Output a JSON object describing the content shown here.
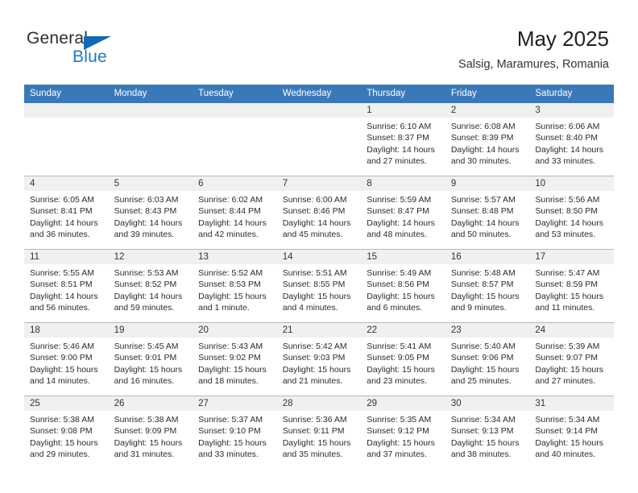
{
  "brand": {
    "word_one": "General",
    "word_two": "Blue",
    "flag_icon": "triangle-flag-icon",
    "accent_color": "#1268b3"
  },
  "header": {
    "title": "May 2025",
    "subtitle": "Salsig, Maramures, Romania"
  },
  "theme": {
    "header_bg": "#3a79b8",
    "header_text": "#ffffff",
    "daynum_bg": "#f0f0f0",
    "cell_bg": "#ffffff",
    "grid_line": "#b8b8b8"
  },
  "calendar": {
    "weekdays": [
      "Sunday",
      "Monday",
      "Tuesday",
      "Wednesday",
      "Thursday",
      "Friday",
      "Saturday"
    ],
    "weeks": [
      [
        {
          "day": "",
          "empty": true
        },
        {
          "day": "",
          "empty": true
        },
        {
          "day": "",
          "empty": true
        },
        {
          "day": "",
          "empty": true
        },
        {
          "day": "1",
          "sunrise": "Sunrise: 6:10 AM",
          "sunset": "Sunset: 8:37 PM",
          "daylight": "Daylight: 14 hours and 27 minutes."
        },
        {
          "day": "2",
          "sunrise": "Sunrise: 6:08 AM",
          "sunset": "Sunset: 8:39 PM",
          "daylight": "Daylight: 14 hours and 30 minutes."
        },
        {
          "day": "3",
          "sunrise": "Sunrise: 6:06 AM",
          "sunset": "Sunset: 8:40 PM",
          "daylight": "Daylight: 14 hours and 33 minutes."
        }
      ],
      [
        {
          "day": "4",
          "sunrise": "Sunrise: 6:05 AM",
          "sunset": "Sunset: 8:41 PM",
          "daylight": "Daylight: 14 hours and 36 minutes."
        },
        {
          "day": "5",
          "sunrise": "Sunrise: 6:03 AM",
          "sunset": "Sunset: 8:43 PM",
          "daylight": "Daylight: 14 hours and 39 minutes."
        },
        {
          "day": "6",
          "sunrise": "Sunrise: 6:02 AM",
          "sunset": "Sunset: 8:44 PM",
          "daylight": "Daylight: 14 hours and 42 minutes."
        },
        {
          "day": "7",
          "sunrise": "Sunrise: 6:00 AM",
          "sunset": "Sunset: 8:46 PM",
          "daylight": "Daylight: 14 hours and 45 minutes."
        },
        {
          "day": "8",
          "sunrise": "Sunrise: 5:59 AM",
          "sunset": "Sunset: 8:47 PM",
          "daylight": "Daylight: 14 hours and 48 minutes."
        },
        {
          "day": "9",
          "sunrise": "Sunrise: 5:57 AM",
          "sunset": "Sunset: 8:48 PM",
          "daylight": "Daylight: 14 hours and 50 minutes."
        },
        {
          "day": "10",
          "sunrise": "Sunrise: 5:56 AM",
          "sunset": "Sunset: 8:50 PM",
          "daylight": "Daylight: 14 hours and 53 minutes."
        }
      ],
      [
        {
          "day": "11",
          "sunrise": "Sunrise: 5:55 AM",
          "sunset": "Sunset: 8:51 PM",
          "daylight": "Daylight: 14 hours and 56 minutes."
        },
        {
          "day": "12",
          "sunrise": "Sunrise: 5:53 AM",
          "sunset": "Sunset: 8:52 PM",
          "daylight": "Daylight: 14 hours and 59 minutes."
        },
        {
          "day": "13",
          "sunrise": "Sunrise: 5:52 AM",
          "sunset": "Sunset: 8:53 PM",
          "daylight": "Daylight: 15 hours and 1 minute."
        },
        {
          "day": "14",
          "sunrise": "Sunrise: 5:51 AM",
          "sunset": "Sunset: 8:55 PM",
          "daylight": "Daylight: 15 hours and 4 minutes."
        },
        {
          "day": "15",
          "sunrise": "Sunrise: 5:49 AM",
          "sunset": "Sunset: 8:56 PM",
          "daylight": "Daylight: 15 hours and 6 minutes."
        },
        {
          "day": "16",
          "sunrise": "Sunrise: 5:48 AM",
          "sunset": "Sunset: 8:57 PM",
          "daylight": "Daylight: 15 hours and 9 minutes."
        },
        {
          "day": "17",
          "sunrise": "Sunrise: 5:47 AM",
          "sunset": "Sunset: 8:59 PM",
          "daylight": "Daylight: 15 hours and 11 minutes."
        }
      ],
      [
        {
          "day": "18",
          "sunrise": "Sunrise: 5:46 AM",
          "sunset": "Sunset: 9:00 PM",
          "daylight": "Daylight: 15 hours and 14 minutes."
        },
        {
          "day": "19",
          "sunrise": "Sunrise: 5:45 AM",
          "sunset": "Sunset: 9:01 PM",
          "daylight": "Daylight: 15 hours and 16 minutes."
        },
        {
          "day": "20",
          "sunrise": "Sunrise: 5:43 AM",
          "sunset": "Sunset: 9:02 PM",
          "daylight": "Daylight: 15 hours and 18 minutes."
        },
        {
          "day": "21",
          "sunrise": "Sunrise: 5:42 AM",
          "sunset": "Sunset: 9:03 PM",
          "daylight": "Daylight: 15 hours and 21 minutes."
        },
        {
          "day": "22",
          "sunrise": "Sunrise: 5:41 AM",
          "sunset": "Sunset: 9:05 PM",
          "daylight": "Daylight: 15 hours and 23 minutes."
        },
        {
          "day": "23",
          "sunrise": "Sunrise: 5:40 AM",
          "sunset": "Sunset: 9:06 PM",
          "daylight": "Daylight: 15 hours and 25 minutes."
        },
        {
          "day": "24",
          "sunrise": "Sunrise: 5:39 AM",
          "sunset": "Sunset: 9:07 PM",
          "daylight": "Daylight: 15 hours and 27 minutes."
        }
      ],
      [
        {
          "day": "25",
          "sunrise": "Sunrise: 5:38 AM",
          "sunset": "Sunset: 9:08 PM",
          "daylight": "Daylight: 15 hours and 29 minutes."
        },
        {
          "day": "26",
          "sunrise": "Sunrise: 5:38 AM",
          "sunset": "Sunset: 9:09 PM",
          "daylight": "Daylight: 15 hours and 31 minutes."
        },
        {
          "day": "27",
          "sunrise": "Sunrise: 5:37 AM",
          "sunset": "Sunset: 9:10 PM",
          "daylight": "Daylight: 15 hours and 33 minutes."
        },
        {
          "day": "28",
          "sunrise": "Sunrise: 5:36 AM",
          "sunset": "Sunset: 9:11 PM",
          "daylight": "Daylight: 15 hours and 35 minutes."
        },
        {
          "day": "29",
          "sunrise": "Sunrise: 5:35 AM",
          "sunset": "Sunset: 9:12 PM",
          "daylight": "Daylight: 15 hours and 37 minutes."
        },
        {
          "day": "30",
          "sunrise": "Sunrise: 5:34 AM",
          "sunset": "Sunset: 9:13 PM",
          "daylight": "Daylight: 15 hours and 38 minutes."
        },
        {
          "day": "31",
          "sunrise": "Sunrise: 5:34 AM",
          "sunset": "Sunset: 9:14 PM",
          "daylight": "Daylight: 15 hours and 40 minutes."
        }
      ]
    ]
  }
}
